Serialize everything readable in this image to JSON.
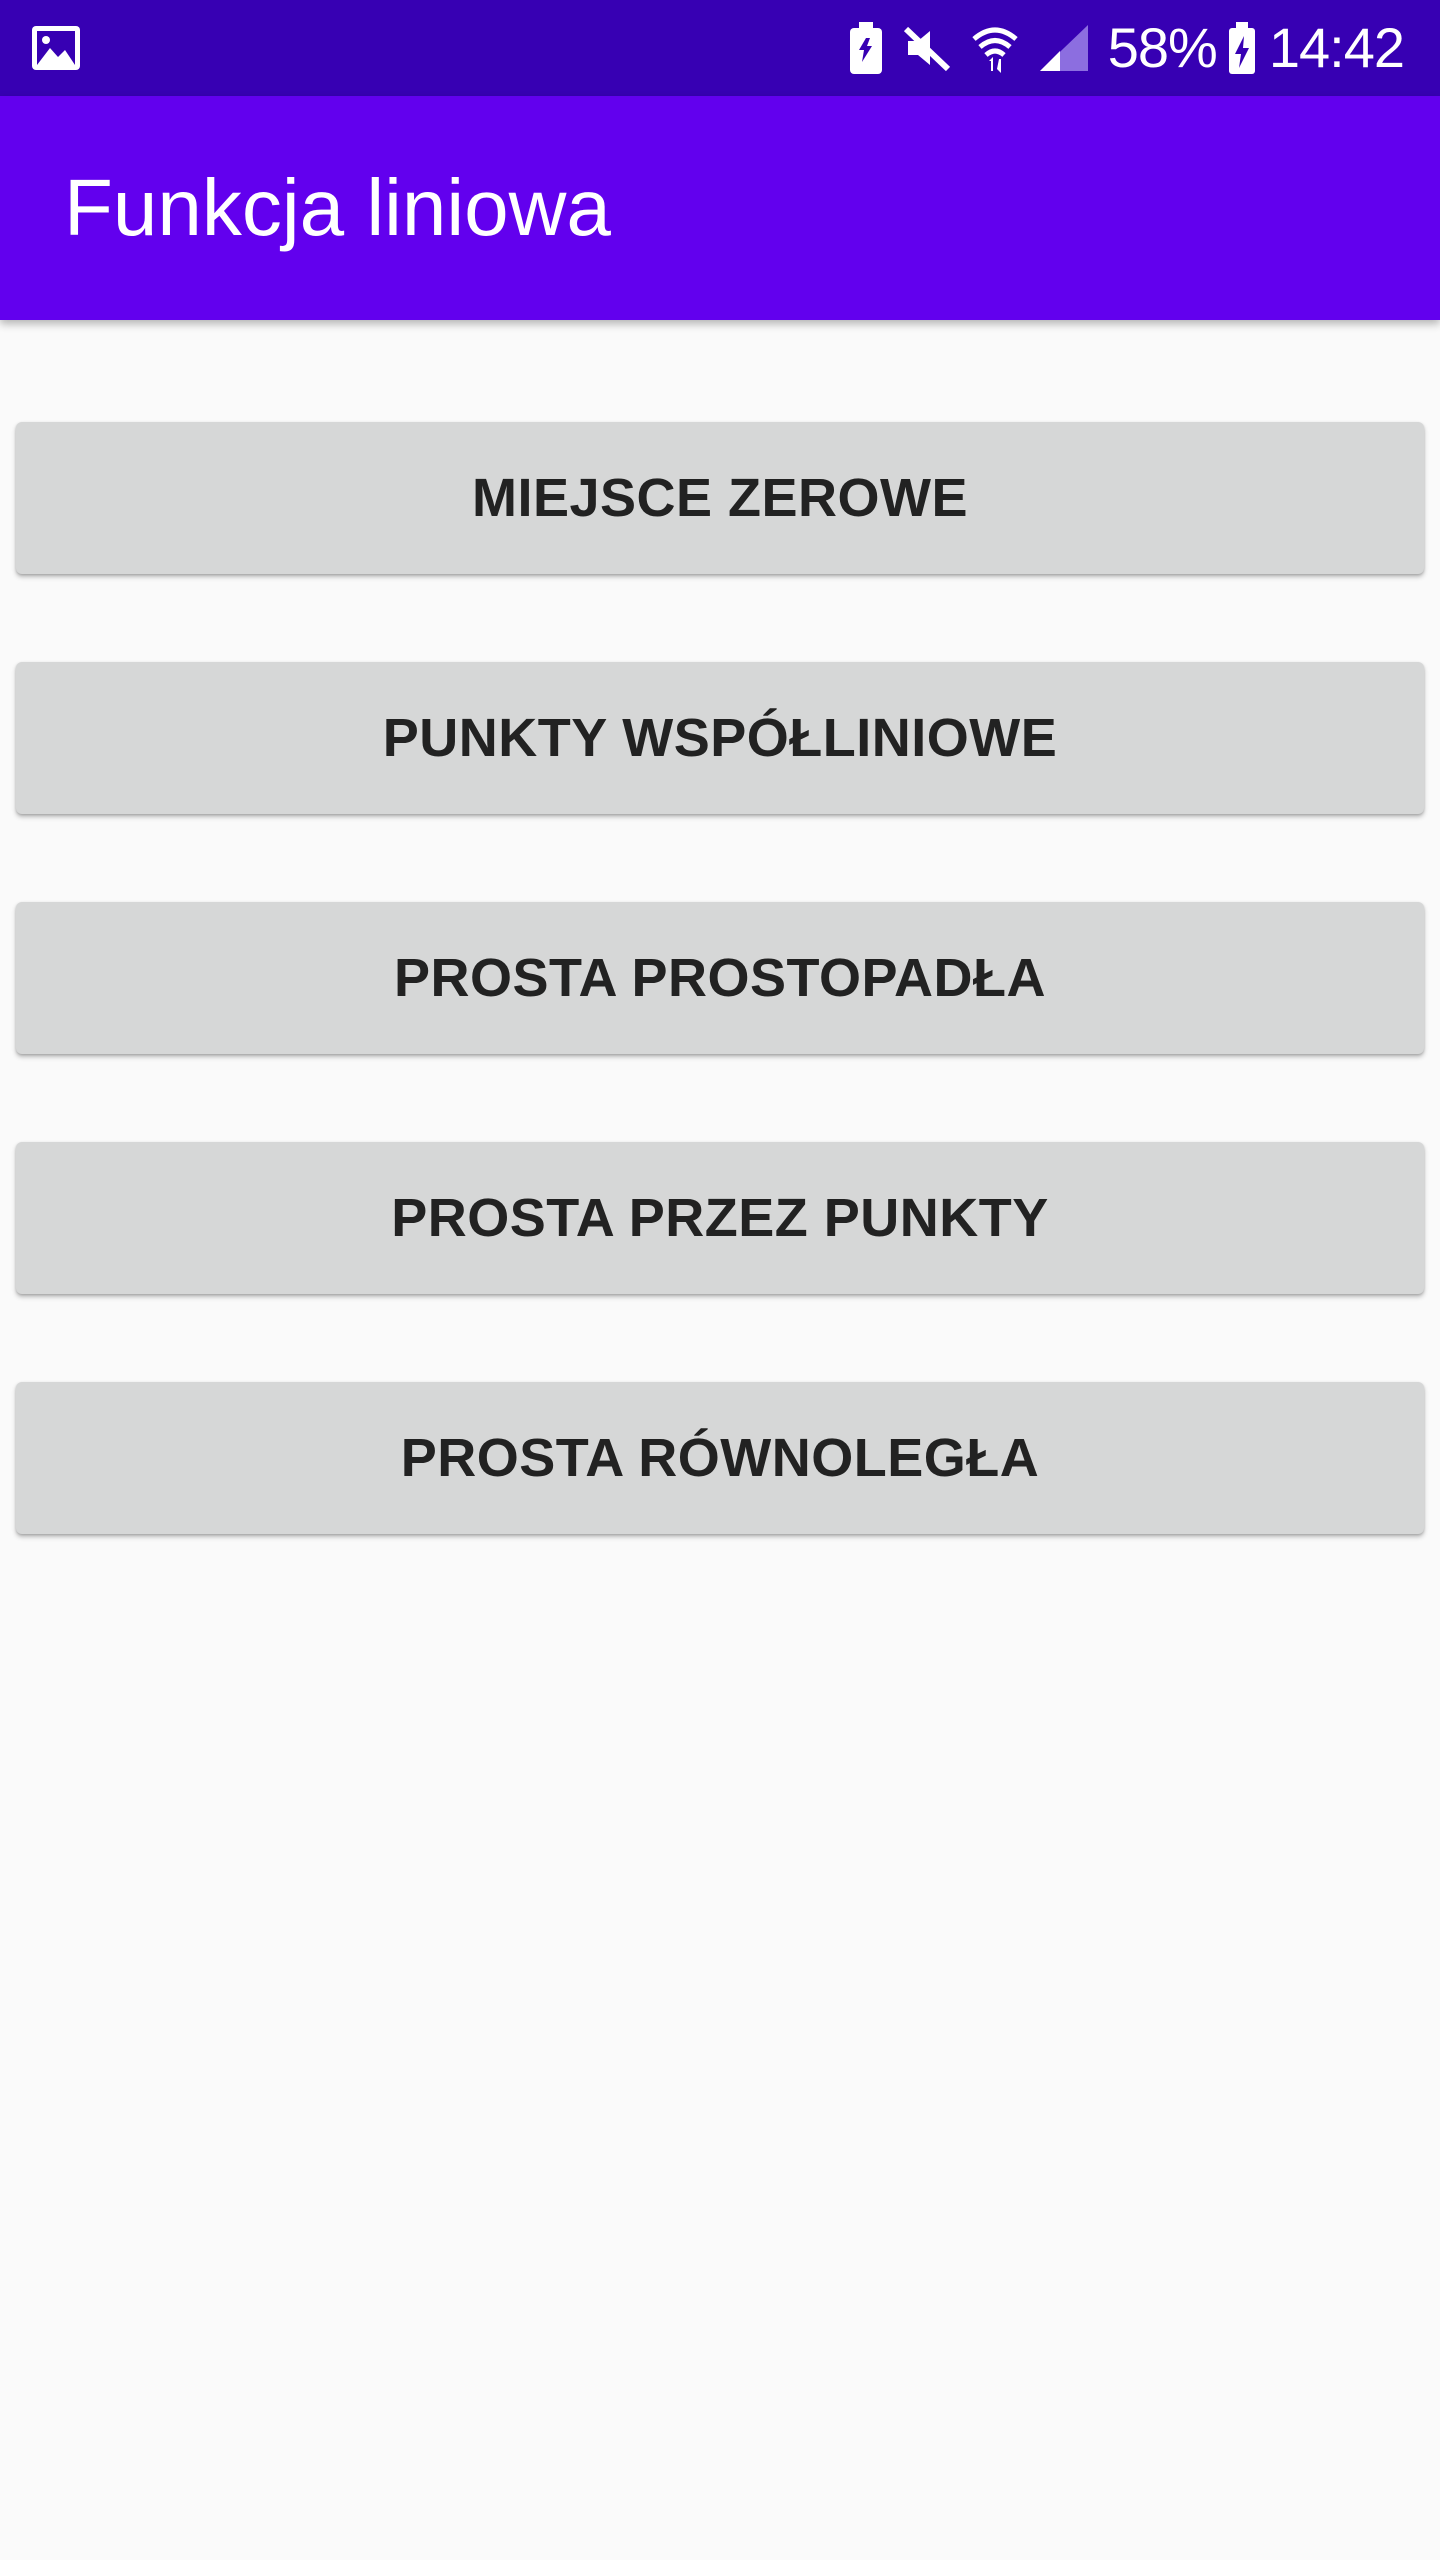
{
  "status_bar": {
    "left_icon": "image-icon",
    "icons": [
      "battery-saver-icon",
      "mute-icon",
      "wifi-icon",
      "signal-icon",
      "battery-charging-icon"
    ],
    "battery_percent": "58%",
    "time": "14:42",
    "background": "#3700b3"
  },
  "app_bar": {
    "title": "Funkcja liniowa",
    "background": "#6200ee"
  },
  "buttons": [
    {
      "label": "MIEJSCE ZEROWE"
    },
    {
      "label": "PUNKTY WSPÓŁLINIOWE"
    },
    {
      "label": "PROSTA PROSTOPADŁA"
    },
    {
      "label": "PROSTA PRZEZ PUNKTY"
    },
    {
      "label": "PROSTA RÓWNOLEGŁA"
    }
  ],
  "colors": {
    "button_background": "#d6d7d7",
    "button_text": "#222222",
    "page_background": "#fafafa"
  }
}
